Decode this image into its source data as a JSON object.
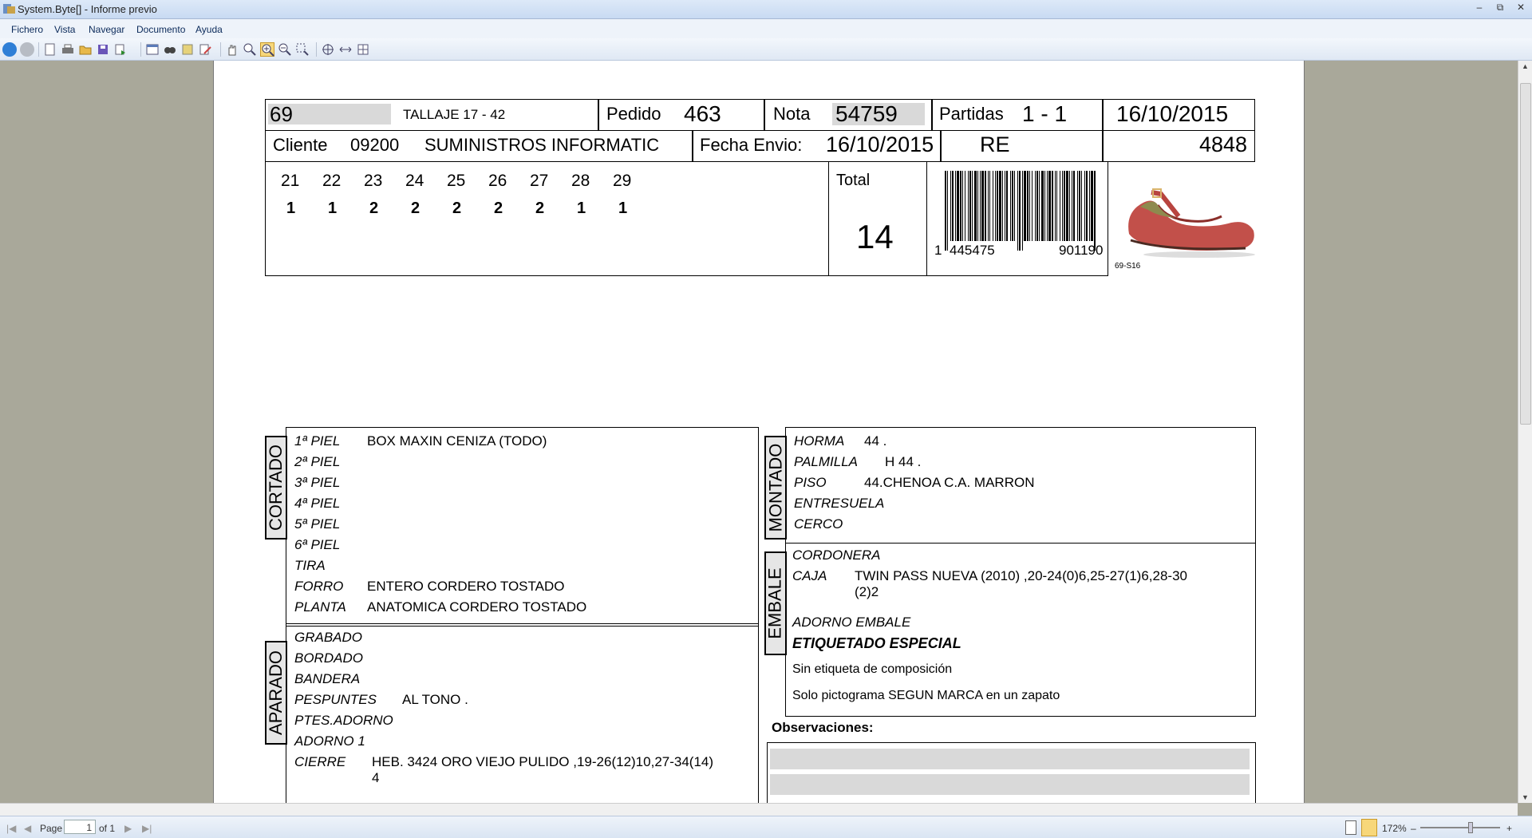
{
  "window": {
    "title": "System.Byte[] - Informe previo"
  },
  "menu": {
    "items": [
      "Fichero",
      "Vista",
      "Navegar",
      "Documento",
      "Ayuda"
    ]
  },
  "header": {
    "article": "69",
    "tallaje": "TALLAJE 17 - 42",
    "pedido_label": "Pedido",
    "pedido": "463",
    "nota_label": "Nota",
    "nota": "54759",
    "partidas_label": "Partidas",
    "partidas": "1 - 1",
    "date": "16/10/2015",
    "cliente_label": "Cliente",
    "cliente_code": "09200",
    "cliente_name": "SUMINISTROS INFORMATIC",
    "fecha_envio_label": "Fecha Envio:",
    "fecha_envio": "16/10/2015",
    "re": "RE",
    "number": "4848"
  },
  "sizes": {
    "labels": [
      "21",
      "22",
      "23",
      "24",
      "25",
      "26",
      "27",
      "28",
      "29"
    ],
    "quantities": [
      "1",
      "1",
      "2",
      "2",
      "2",
      "2",
      "2",
      "1",
      "1"
    ],
    "total_label": "Total",
    "total": "14"
  },
  "barcode": {
    "first": "1",
    "left": "445475",
    "right": "901190"
  },
  "photo": {
    "caption": "69-S16"
  },
  "cortado": {
    "title": "CORTADO",
    "rows": [
      {
        "label": "1ª PIEL",
        "value": "BOX MAXIN CENIZA (TODO)"
      },
      {
        "label": "2ª PIEL",
        "value": ""
      },
      {
        "label": "3ª PIEL",
        "value": ""
      },
      {
        "label": "4ª PIEL",
        "value": ""
      },
      {
        "label": "5ª PIEL",
        "value": ""
      },
      {
        "label": "6ª PIEL",
        "value": ""
      },
      {
        "label": "TIRA",
        "value": ""
      },
      {
        "label": "FORRO",
        "value": "ENTERO CORDERO TOSTADO"
      },
      {
        "label": "PLANTA",
        "value": "ANATOMICA CORDERO TOSTADO"
      }
    ]
  },
  "aparado": {
    "title": "APARADO",
    "rows": [
      {
        "label": "GRABADO",
        "value": ""
      },
      {
        "label": "BORDADO",
        "value": ""
      },
      {
        "label": "BANDERA",
        "value": ""
      },
      {
        "label": "PESPUNTES",
        "value": "AL TONO ."
      },
      {
        "label": "PTES.ADORNO",
        "value": ""
      },
      {
        "label": "ADORNO 1",
        "value": ""
      },
      {
        "label": "CIERRE",
        "value": "HEB. 3424 ORO VIEJO PULIDO ,19-26(12)10,27-34(14)",
        "value2": "4"
      }
    ]
  },
  "montado": {
    "title": "MONTADO",
    "rows": [
      {
        "label": "HORMA",
        "value": "44 ."
      },
      {
        "label": "PALMILLA",
        "value": "H 44 ."
      },
      {
        "label": "PISO",
        "value": "44.CHENOA C.A. MARRON"
      },
      {
        "label": "ENTRESUELA",
        "value": ""
      },
      {
        "label": "CERCO",
        "value": ""
      }
    ]
  },
  "embale": {
    "title": "EMBALE",
    "cordonera": "CORDONERA",
    "caja_label": "CAJA",
    "caja_value": "TWIN PASS NUEVA (2010) ,20-24(0)6,25-27(1)6,28-30",
    "caja_value2": "(2)2",
    "adorno": "ADORNO EMBALE",
    "etiquetado": "ETIQUETADO ESPECIAL",
    "note1": "Sin etiqueta de composición",
    "note2": "Solo pictograma SEGUN MARCA en un zapato"
  },
  "observaciones": {
    "label": "Observaciones:"
  },
  "status": {
    "page_label": "Page",
    "page": "1",
    "of_label": "of 1",
    "zoom": "172%"
  }
}
